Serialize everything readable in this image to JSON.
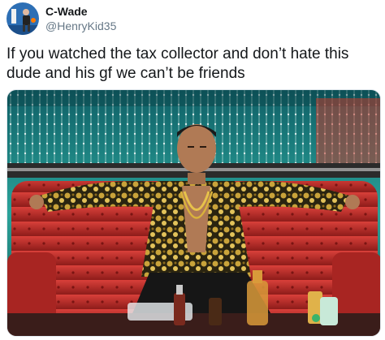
{
  "tweet": {
    "author": {
      "display_name": "C-Wade",
      "handle": "@HenryKid35",
      "avatar_icon": "profile-photo-avatar"
    },
    "text": "If you watched the tax collector and don’t hate this dude and his gf we can’t be friends",
    "media": {
      "icon": "attached-photo",
      "accent_colors": {
        "couch_red": "#c8302c",
        "background_teal": "#1f8f8a",
        "shirt_gold": "#c9a33a"
      }
    }
  }
}
